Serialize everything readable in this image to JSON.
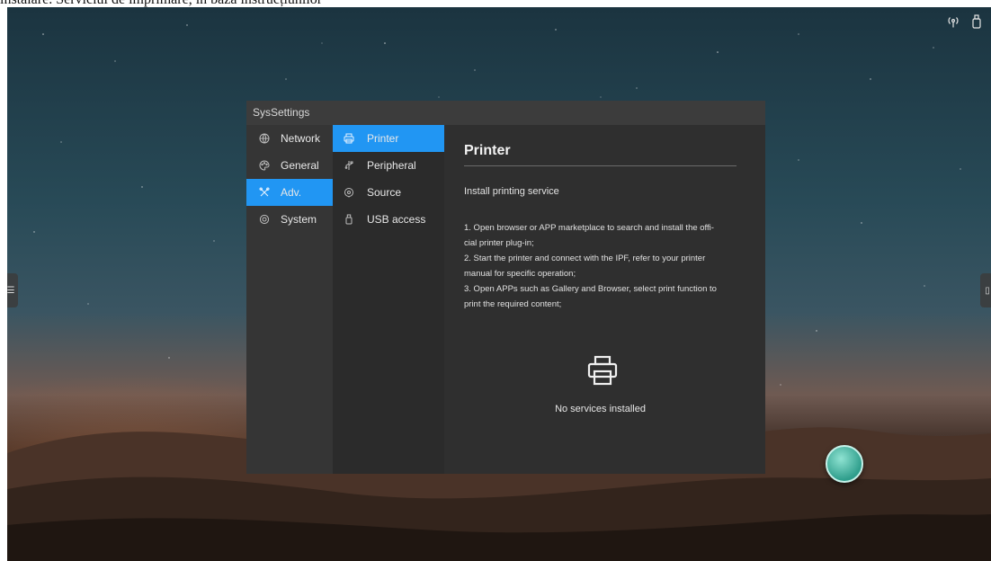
{
  "caption": "instalare. Serviciul de imprimare, în baza instrucțiunilor",
  "window": {
    "title": "SysSettings"
  },
  "primary_nav": [
    {
      "label": "Network",
      "icon": "globe-icon",
      "active": false
    },
    {
      "label": "General",
      "icon": "palette-icon",
      "active": false
    },
    {
      "label": "Adv.",
      "icon": "tools-icon",
      "active": true
    },
    {
      "label": "System",
      "icon": "gear-icon",
      "active": false
    }
  ],
  "secondary_nav": [
    {
      "label": "Printer",
      "icon": "printer-icon",
      "active": true
    },
    {
      "label": "Peripheral",
      "icon": "usb-icon",
      "active": false
    },
    {
      "label": "Source",
      "icon": "source-icon",
      "active": false
    },
    {
      "label": "USB access",
      "icon": "usb-drive-icon",
      "active": false
    }
  ],
  "content": {
    "title": "Printer",
    "section_label": "Install printing service",
    "steps": [
      "1. Open browser or APP marketplace to search and install the offi-\ncial printer plug-in;",
      "2. Start the printer and connect with the IPF, refer to your printer\nmanual for specific operation;",
      "3. Open APPs such as Gallery and Browser, select print function to\nprint the required content;"
    ],
    "empty_state": "No services installed"
  },
  "status_icons": [
    "wireless-icon",
    "usb-icon"
  ],
  "colors": {
    "accent": "#2196f3",
    "panel": "#2f2f2f",
    "float_ball": "#2f9e8c"
  }
}
